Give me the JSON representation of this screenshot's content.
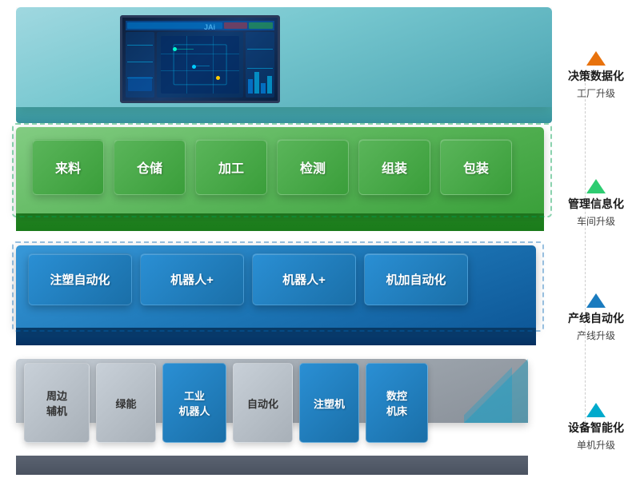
{
  "layers": {
    "decision": {
      "label_main": "决策数据化",
      "label_sub": "工厂升级",
      "arrow_color": "orange"
    },
    "management": {
      "label_main": "管理信息化",
      "label_sub": "车间升级",
      "arrow_color": "green",
      "cards": [
        "来料",
        "仓储",
        "加工",
        "检测",
        "组装",
        "包装"
      ]
    },
    "production": {
      "label_main": "产线自动化",
      "label_sub": "产线升级",
      "arrow_color": "blue",
      "cards": [
        "注塑自动化",
        "机器人+",
        "机器人+",
        "机加自动化"
      ]
    },
    "equipment": {
      "label_main": "设备智能化",
      "label_sub": "单机升级",
      "arrow_color": "teal",
      "cards": [
        {
          "label": "周边\n辅机",
          "type": "gray"
        },
        {
          "label": "绿能",
          "type": "gray"
        },
        {
          "label": "工业\n机器人",
          "type": "blue"
        },
        {
          "label": "自动化",
          "type": "gray"
        },
        {
          "label": "注塑机",
          "type": "blue"
        },
        {
          "label": "数控\n机床",
          "type": "blue"
        }
      ]
    }
  }
}
